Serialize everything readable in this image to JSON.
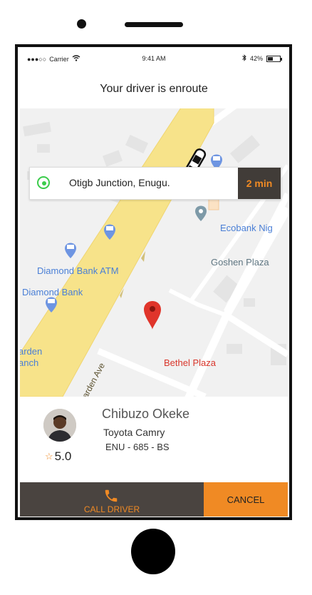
{
  "status_bar": {
    "signal_dots": "●●●○○",
    "carrier": "Carrier",
    "time": "9:41 AM",
    "battery": "42%",
    "battery_level": 0.42
  },
  "header": {
    "title": "Your driver is enroute"
  },
  "destination": {
    "name": "Otigb Junction, Enugu.",
    "eta": "2 min"
  },
  "map": {
    "places": {
      "ecobank": "Ecobank Nig",
      "goshen": "Goshen Plaza",
      "diamond_atm": "Diamond Bank ATM",
      "diamond": "Diamond Bank",
      "garden_1": "arden",
      "garden_2": "anch",
      "bethel": "Bethel Plaza",
      "road": "Garden Ave"
    },
    "colors": {
      "road": "#f7e38a",
      "pin": "#e0352b",
      "poi": "#5b8de0",
      "park_pin": "#7e9aa8"
    }
  },
  "driver": {
    "name": "Chibuzo Okeke",
    "car": "Toyota Camry",
    "plate": "ENU - 685 - BS",
    "rating": "5.0"
  },
  "actions": {
    "call": "CALL DRIVER",
    "cancel": "CANCEL"
  },
  "colors": {
    "accent": "#f08a24",
    "dark": "#4a4440",
    "online": "#3bcc4b"
  }
}
